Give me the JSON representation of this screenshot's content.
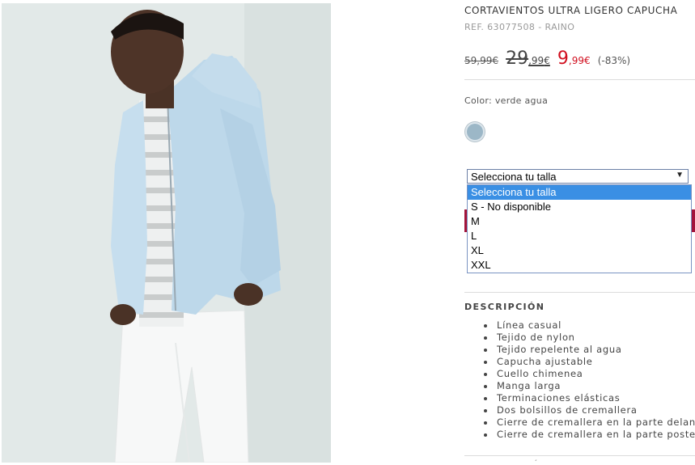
{
  "product": {
    "image_alt": "Modelo con cortavientos azul claro",
    "title": "CORTAVIENTOS ULTRA LIGERO CAPUCHA",
    "ref": "REF. 63077508 - RAINO",
    "price_original": {
      "main": "59,99",
      "currency": "€"
    },
    "price_previous": {
      "main": "29",
      "cents": ",99",
      "currency": "€"
    },
    "price_current": {
      "main": "9",
      "cents": ",99",
      "currency": "€"
    },
    "discount": "(-83%)",
    "color_label": "Color: verde agua",
    "swatch_color": "#9cb7c7"
  },
  "size_select": {
    "selected": "Selecciona tu talla",
    "arrow_icon": "triangle-down",
    "options": [
      "Selecciona tu talla",
      "S - No disponible",
      "M",
      "L",
      "XL",
      "XXL"
    ]
  },
  "description": {
    "heading": "DESCRIPCIÓN",
    "items": [
      "Línea casual",
      "Tejido de nylon",
      "Tejido repelente al agua",
      "Capucha ajustable",
      "Cuello chimenea",
      "Manga larga",
      "Terminaciones elásticas",
      "Dos bolsillos de cremallera",
      "Cierre de cremallera en la parte delan",
      "Cierre de cremallera en la parte poste"
    ]
  },
  "colors": {
    "accent": "#a3143b",
    "sale": "#d10f1f",
    "highlight": "#3a8fe4"
  }
}
